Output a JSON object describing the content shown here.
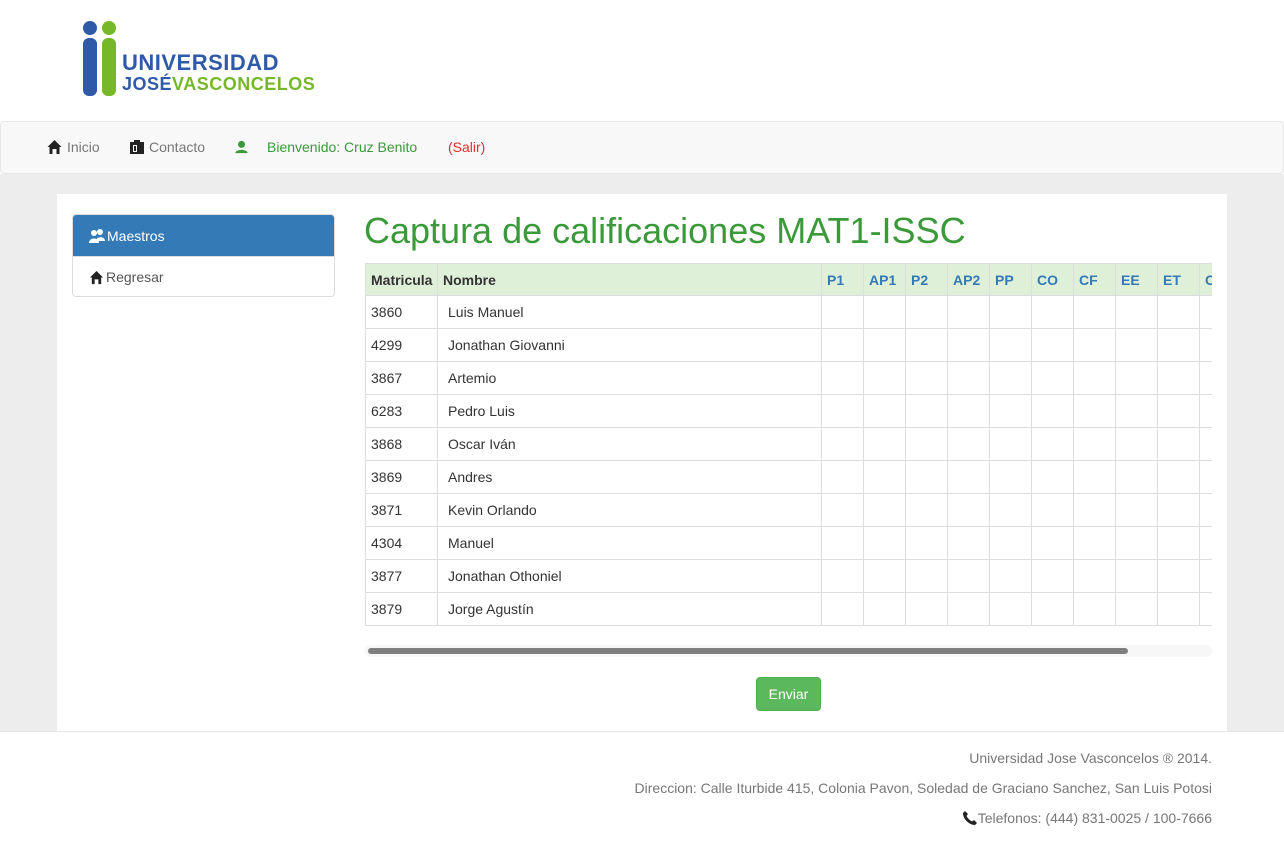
{
  "logo": {
    "line1": "UNIVERSIDAD",
    "line2_a": "JOSÉ",
    "line2_b": "VASCONCELOS"
  },
  "colors": {
    "brand_green": "#3a9a3a",
    "brand_blue": "#337ab7",
    "header_green": "#dff0d8",
    "logout_red": "#e0302b",
    "button_green": "#5cb85c"
  },
  "nav": {
    "home": {
      "label": "Inicio",
      "icon": "home-icon"
    },
    "contact": {
      "label": "Contacto",
      "icon": "contact-card-icon"
    },
    "welcome": {
      "label": "Bienvenido: Cruz Benito",
      "icon": "user-icon"
    },
    "logout": {
      "label": "(Salir)"
    }
  },
  "sidebar": {
    "items": [
      {
        "label": "Maestros",
        "icon": "teachers-icon",
        "active": true
      },
      {
        "label": "Regresar",
        "icon": "home-icon",
        "active": false
      }
    ]
  },
  "page": {
    "title": "Captura de calificaciones MAT1-ISSC"
  },
  "table": {
    "headers": {
      "matricula": "Matricula",
      "nombre": "Nombre"
    },
    "grade_headers": [
      "P1",
      "AP1",
      "P2",
      "AP2",
      "PP",
      "CO",
      "CF",
      "EE",
      "ET",
      "C"
    ],
    "rows": [
      {
        "matricula": "3860",
        "nombre": "Luis Manuel"
      },
      {
        "matricula": "4299",
        "nombre": "Jonathan Giovanni"
      },
      {
        "matricula": "3867",
        "nombre": "Artemio"
      },
      {
        "matricula": "6283",
        "nombre": "Pedro Luis"
      },
      {
        "matricula": "3868",
        "nombre": "Oscar Iván"
      },
      {
        "matricula": "3869",
        "nombre": "Andres"
      },
      {
        "matricula": "3871",
        "nombre": "Kevin Orlando"
      },
      {
        "matricula": "4304",
        "nombre": "Manuel"
      },
      {
        "matricula": "3877",
        "nombre": "Jonathan Othoniel"
      },
      {
        "matricula": "3879",
        "nombre": "Jorge Agustín"
      }
    ]
  },
  "submit": {
    "label": "Enviar"
  },
  "footer": {
    "copyright": "Universidad Jose Vasconcelos ® 2014.",
    "address": "Direccion: Calle Iturbide 415, Colonia Pavon, Soledad de Graciano Sanchez, San Luis Potosi",
    "phone": "Telefonos: (444) 831-0025 / 100-7666",
    "phone_icon": "phone-icon"
  }
}
